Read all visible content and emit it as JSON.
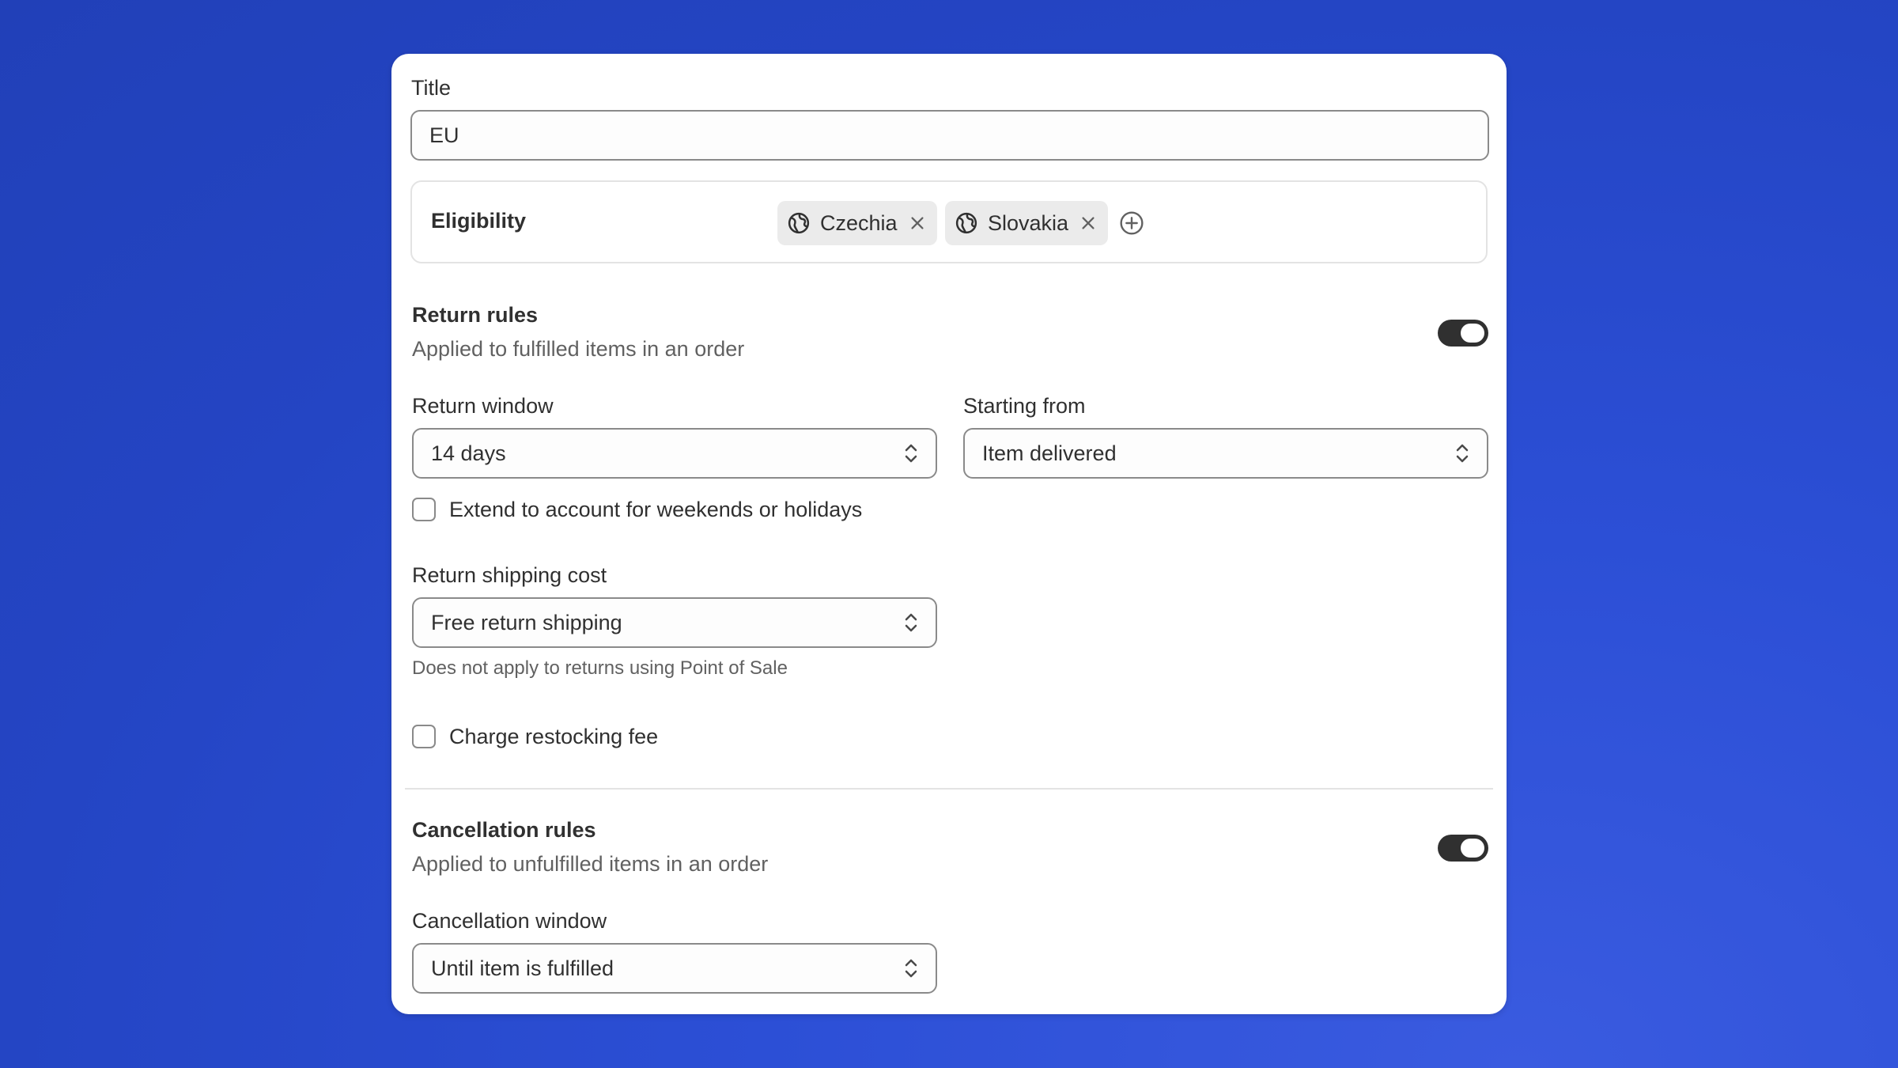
{
  "title_field": {
    "label": "Title",
    "value": "EU"
  },
  "eligibility": {
    "label": "Eligibility",
    "chips": [
      {
        "label": "Czechia",
        "icon": "globe-icon"
      },
      {
        "label": "Slovakia",
        "icon": "globe-icon"
      }
    ],
    "add_icon": "plus-circle-icon"
  },
  "return_rules": {
    "heading": "Return rules",
    "description": "Applied to fulfilled items in an order",
    "enabled": true,
    "return_window": {
      "label": "Return window",
      "value": "14 days"
    },
    "starting_from": {
      "label": "Starting from",
      "value": "Item delivered"
    },
    "extend_checkbox": {
      "label": "Extend to account for weekends or holidays",
      "checked": false
    },
    "shipping_cost": {
      "label": "Return shipping cost",
      "value": "Free return shipping",
      "help": "Does not apply to returns using Point of Sale"
    },
    "restocking_checkbox": {
      "label": "Charge restocking fee",
      "checked": false
    }
  },
  "cancellation_rules": {
    "heading": "Cancellation rules",
    "description": "Applied to unfulfilled items in an order",
    "enabled": true,
    "window": {
      "label": "Cancellation window",
      "value": "Until item is fulfilled"
    }
  },
  "colors": {
    "background": "#2c4fd6",
    "card": "#ffffff",
    "toggle_on": "#303030",
    "chip_bg": "#ebebeb",
    "border": "#8a8a8a"
  }
}
